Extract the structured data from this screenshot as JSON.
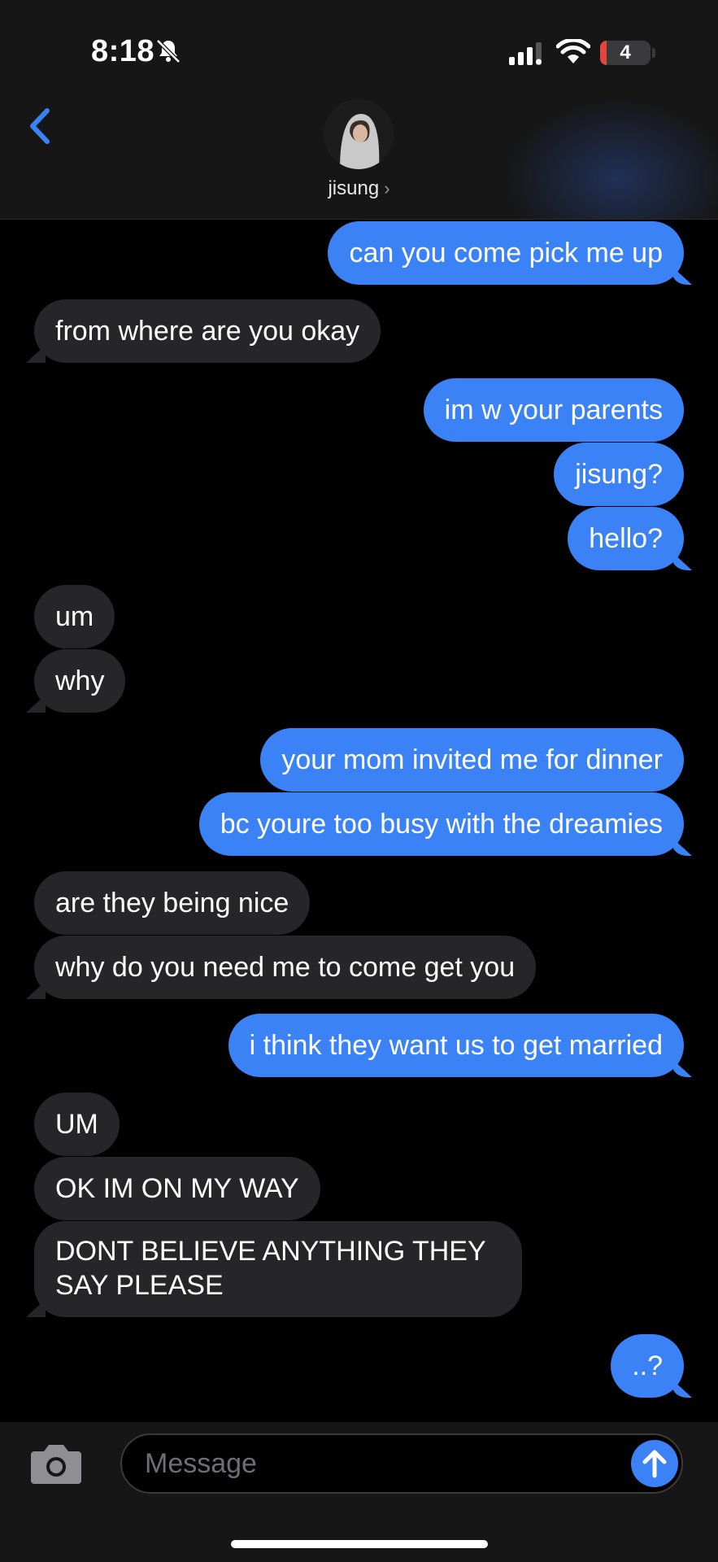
{
  "status_bar": {
    "time": "8:18",
    "battery": "4"
  },
  "contact": {
    "name": "jisung",
    "chevron": "›"
  },
  "messages": [
    {
      "from": "me",
      "text": "can you come pick me up"
    },
    {
      "from": "them",
      "text": "from where are you okay"
    },
    {
      "from": "me",
      "text": "im w your parents"
    },
    {
      "from": "me",
      "text": "jisung?"
    },
    {
      "from": "me",
      "text": "hello?"
    },
    {
      "from": "them",
      "text": "um"
    },
    {
      "from": "them",
      "text": "why"
    },
    {
      "from": "me",
      "text": "your mom invited me for dinner"
    },
    {
      "from": "me",
      "text": "bc youre too busy with the dreamies"
    },
    {
      "from": "them",
      "text": "are they being nice"
    },
    {
      "from": "them",
      "text": "why do you need me to come get you"
    },
    {
      "from": "me",
      "text": "i think they want us to get married"
    },
    {
      "from": "them",
      "text": "UM"
    },
    {
      "from": "them",
      "text": "OK IM ON MY WAY"
    },
    {
      "from": "them",
      "text": "DONT BELIEVE ANYTHING THEY SAY PLEASE"
    },
    {
      "from": "me",
      "text": "..?"
    }
  ],
  "composer": {
    "placeholder": "Message"
  },
  "icons": {
    "back": "chevron-left-icon",
    "bell": "bell-slash-icon",
    "camera": "camera-icon",
    "send": "arrow-up-icon"
  },
  "colors": {
    "accent": "#3b82f6",
    "outgoing_bubble": "#3b82f6",
    "incoming_bubble": "#262628",
    "background": "#000000"
  }
}
